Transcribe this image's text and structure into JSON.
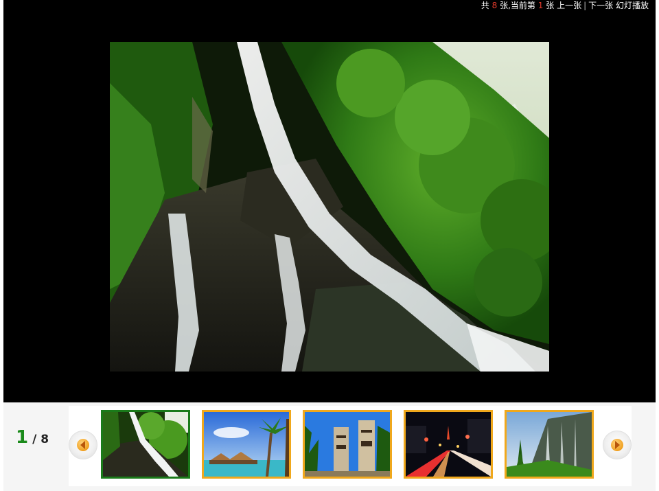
{
  "viewer": {
    "total_prefix": "共",
    "total_count": "8",
    "total_mid": "张,当前第",
    "current_index": "1",
    "current_suffix": "张",
    "prev_label": "上一张",
    "separator": "|",
    "next_label": "下一张",
    "slideshow_label": "幻灯播放",
    "highlight_color": "#e53b2c"
  },
  "counter": {
    "current": "1",
    "total": "/ 8"
  },
  "thumbnails": [
    {
      "subject": "waterfall",
      "active": true
    },
    {
      "subject": "tropical beach huts"
    },
    {
      "subject": "tiki statues"
    },
    {
      "subject": "city night traffic"
    },
    {
      "subject": "mountain cliff waterfall"
    }
  ],
  "colors": {
    "active_border": "#1a7a1a",
    "thumb_border": "#f0a81c",
    "counter_current": "#1a8a1a"
  }
}
